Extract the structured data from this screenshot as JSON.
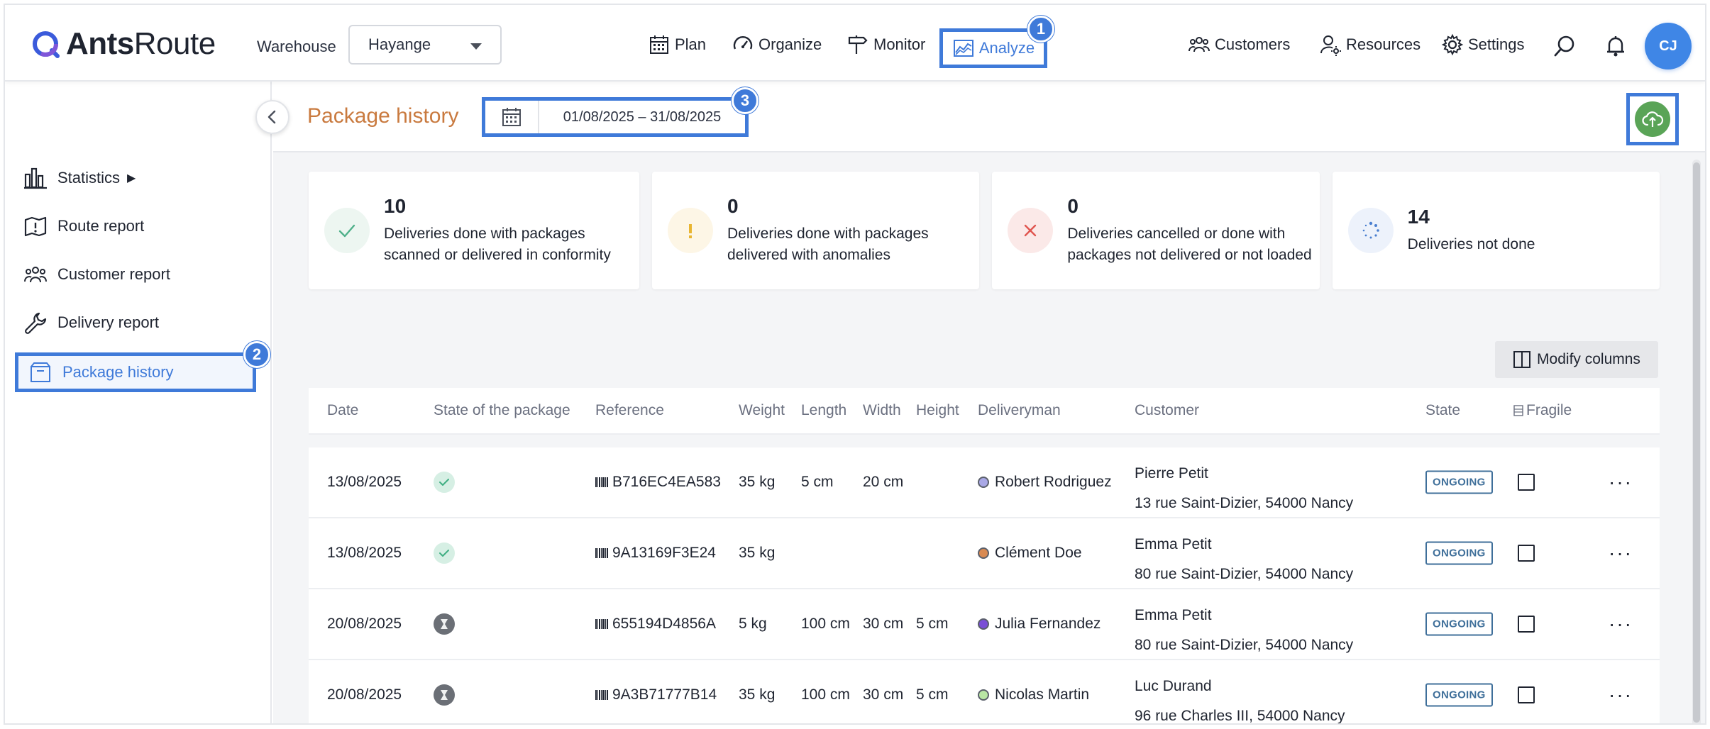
{
  "brand": {
    "bold": "Ants",
    "light": "Route"
  },
  "warehouse": {
    "label": "Warehouse",
    "selected": "Hayange"
  },
  "nav": {
    "plan": "Plan",
    "organize": "Organize",
    "monitor": "Monitor",
    "analyze": "Analyze",
    "customers": "Customers",
    "resources": "Resources",
    "settings": "Settings"
  },
  "user": {
    "initials": "CJ"
  },
  "badges": {
    "one": "1",
    "two": "2",
    "three": "3"
  },
  "sidebar": {
    "items": [
      {
        "label": "Statistics",
        "arrow": "▶"
      },
      {
        "label": "Route report"
      },
      {
        "label": "Customer report"
      },
      {
        "label": "Delivery report"
      },
      {
        "label": "Package history"
      }
    ]
  },
  "page": {
    "title": "Package history",
    "date_range": "01/08/2025 – 31/08/2025"
  },
  "cards": [
    {
      "count": "10",
      "text": "Deliveries done with packages scanned or delivered in conformity",
      "color": "#4fb08a"
    },
    {
      "count": "0",
      "text": "Deliveries done with packages delivered with anomalies",
      "color": "#e9b531"
    },
    {
      "count": "0",
      "text": "Deliveries cancelled or done with packages not delivered or not loaded",
      "color": "#e0554f"
    },
    {
      "count": "14",
      "text": "Deliveries not done",
      "color": "#4a7fd0"
    }
  ],
  "modify_columns": "Modify columns",
  "table": {
    "columns": {
      "date": "Date",
      "state_pkg": "State of the package",
      "reference": "Reference",
      "weight": "Weight",
      "length": "Length",
      "width": "Width",
      "height": "Height",
      "deliveryman": "Deliveryman",
      "customer": "Customer",
      "state": "State",
      "fragile": "Fragile"
    },
    "rows": [
      {
        "date": "13/08/2025",
        "state_pkg": "ok",
        "reference": "B716EC4EA583",
        "weight": "35 kg",
        "length": "5 cm",
        "width": "20 cm",
        "height": "",
        "deliveryman": "Robert Rodriguez",
        "dot": "#a9a8e6",
        "customer": "Pierre Petit",
        "address": "13 rue Saint-Dizier, 54000 Nancy",
        "state": "ONGOING"
      },
      {
        "date": "13/08/2025",
        "state_pkg": "ok",
        "reference": "9A13169F3E24",
        "weight": "35 kg",
        "length": "",
        "width": "",
        "height": "",
        "deliveryman": "Clément Doe",
        "dot": "#d98a52",
        "customer": "Emma Petit",
        "address": "80 rue Saint-Dizier, 54000 Nancy",
        "state": "ONGOING"
      },
      {
        "date": "20/08/2025",
        "state_pkg": "wait",
        "reference": "655194D4856A",
        "weight": "5 kg",
        "length": "100 cm",
        "width": "30 cm",
        "height": "5 cm",
        "deliveryman": "Julia Fernandez",
        "dot": "#7a4fd6",
        "customer": "Emma Petit",
        "address": "80 rue Saint-Dizier, 54000 Nancy",
        "state": "ONGOING"
      },
      {
        "date": "20/08/2025",
        "state_pkg": "wait",
        "reference": "9A3B71777B14",
        "weight": "35 kg",
        "length": "100 cm",
        "width": "30 cm",
        "height": "5 cm",
        "deliveryman": "Nicolas Martin",
        "dot": "#b9e6a4",
        "customer": "Luc Durand",
        "address": "96 rue Charles III, 54000 Nancy",
        "state": "ONGOING"
      }
    ]
  },
  "colors": {
    "accent": "#3f7ad9",
    "title": "#c97a3f",
    "export": "#5aa457"
  }
}
